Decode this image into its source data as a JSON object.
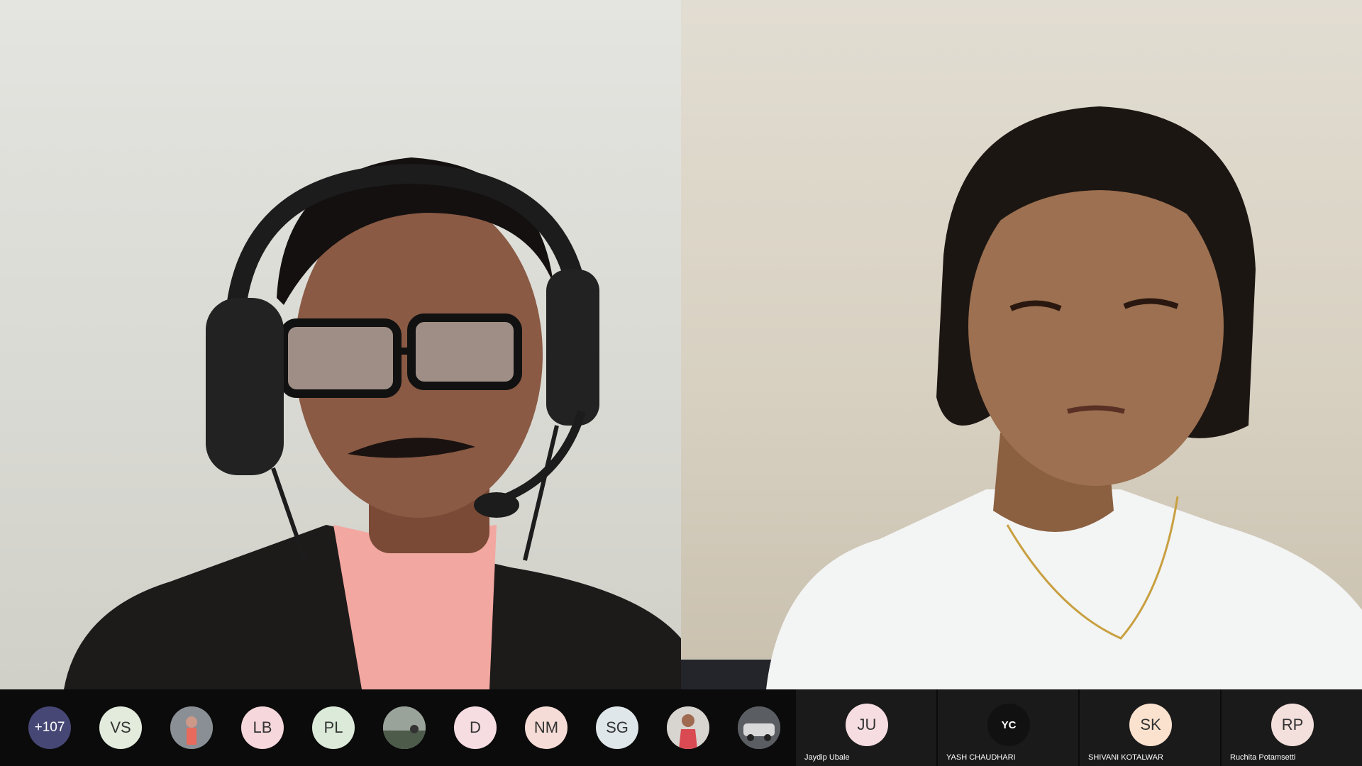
{
  "app": "video-meeting",
  "gallery": {
    "tiles": [
      {
        "id": "speaker-left",
        "kind": "video"
      },
      {
        "id": "speaker-right",
        "kind": "video"
      }
    ]
  },
  "strip": {
    "overflow_label": "+107",
    "avatars": [
      {
        "type": "initials",
        "text": "VS",
        "color": "#e3ecdc"
      },
      {
        "type": "photo",
        "icon": "person-photo-icon"
      },
      {
        "type": "initials",
        "text": "LB",
        "color": "#f5d7dc"
      },
      {
        "type": "initials",
        "text": "PL",
        "color": "#dcebd9"
      },
      {
        "type": "photo",
        "icon": "person-photo-icon"
      },
      {
        "type": "initials",
        "text": "D",
        "color": "#f6dde2"
      },
      {
        "type": "initials",
        "text": "NM",
        "color": "#f5dcd6"
      },
      {
        "type": "initials",
        "text": "SG",
        "color": "#dfe7ea"
      },
      {
        "type": "photo",
        "icon": "person-photo-icon"
      },
      {
        "type": "photo",
        "icon": "car-photo-icon"
      }
    ],
    "named": [
      {
        "initials": "JU",
        "name": "Jaydip Ubale",
        "color": "#f6dde2"
      },
      {
        "initials": "YC",
        "name": "YASH CHAUDHARI",
        "color": "#111111"
      },
      {
        "initials": "SK",
        "name": "SHIVANI KOTALWAR",
        "color": "#fbe2cf"
      },
      {
        "initials": "RP",
        "name": "Ruchita Potamsetti",
        "color": "#f3dfdb"
      }
    ]
  }
}
